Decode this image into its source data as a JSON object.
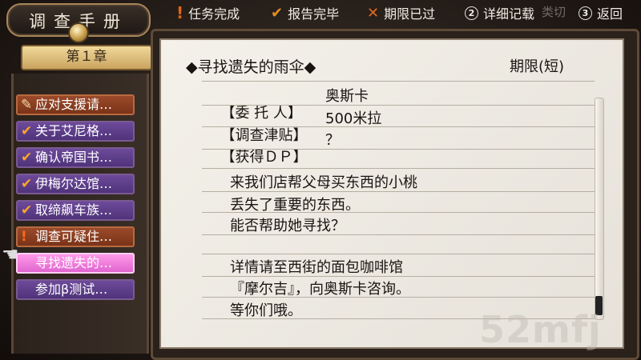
{
  "legend": {
    "items": [
      {
        "icon": "exclamation-icon",
        "glyph": "!",
        "label": "任务完成"
      },
      {
        "icon": "check-icon",
        "glyph": "✔",
        "label": "报告完毕"
      },
      {
        "icon": "cross-icon",
        "glyph": "✕",
        "label": "期限已过"
      },
      {
        "icon": "circle-2-icon",
        "glyph": "②",
        "label": "详细记载"
      },
      {
        "icon": "circle-3-icon",
        "glyph": "③",
        "label": "返回"
      }
    ],
    "ghost_text": "类切"
  },
  "book": {
    "title": "调查手册",
    "chapter": "第１章"
  },
  "quests": [
    {
      "mark": "pencil",
      "glyph": "✎",
      "label": "应对支援请…",
      "style": "orange"
    },
    {
      "mark": "check",
      "glyph": "✔",
      "label": "关于艾尼格…",
      "style": "purple"
    },
    {
      "mark": "check",
      "glyph": "✔",
      "label": "确认帝国书…",
      "style": "purple"
    },
    {
      "mark": "check",
      "glyph": "✔",
      "label": "伊梅尔达馆…",
      "style": "purple"
    },
    {
      "mark": "check",
      "glyph": "✔",
      "label": "取缔飙车族…",
      "style": "purple"
    },
    {
      "mark": "excl",
      "glyph": "!",
      "label": "调查可疑住…",
      "style": "orange"
    },
    {
      "mark": "none",
      "glyph": "",
      "label": "寻找遗失的…",
      "style": "selected"
    },
    {
      "mark": "none",
      "glyph": "",
      "label": "参加β测试…",
      "style": "purple"
    }
  ],
  "detail": {
    "title": "◆寻找遗失的雨伞◆",
    "deadline": "期限(短)",
    "fields": [
      {
        "label": "【委 托 人】",
        "value": "奥斯卡"
      },
      {
        "label": "【调查津贴】",
        "value": "500米拉"
      },
      {
        "label": "【获得ＤＰ】",
        "value": "？"
      }
    ],
    "paragraphs": [
      "来我们店帮父母买东西的小桃",
      "丢失了重要的东西。",
      "能否帮助她寻找？",
      "详情请至西街的面包咖啡馆",
      "『摩尔吉』，向奥斯卡咨询。",
      "等你们哦。"
    ]
  },
  "watermark": "52mfj"
}
